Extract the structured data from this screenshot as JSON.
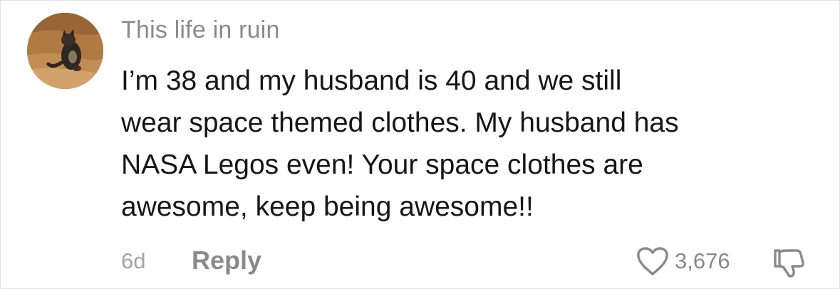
{
  "comment": {
    "username": "This life in ruin",
    "avatar_icon": "cat-on-couch-avatar",
    "text_lines": [
      "I’m 38 and my husband is 40 and we still",
      "wear space themed clothes. My husband has",
      "NASA Legos even! Your space clothes are",
      "awesome, keep being awesome!!"
    ],
    "time_ago": "6d",
    "reply_label": "Reply",
    "like_icon": "heart-outline-icon",
    "like_count": "3,676",
    "dislike_icon": "thumbs-down-icon"
  },
  "colors": {
    "username": "#8a8a8a",
    "text": "#161616",
    "meta": "#a3a3a3",
    "icon": "#8a8a8a"
  }
}
